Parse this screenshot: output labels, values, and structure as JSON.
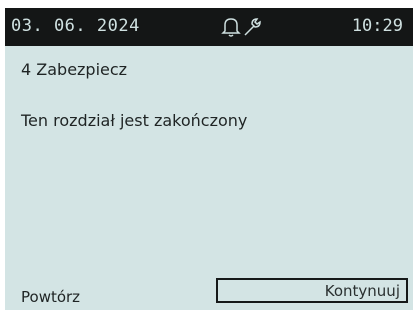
{
  "status_bar": {
    "date": "03. 06. 2024",
    "time": "10:29",
    "icons": [
      "bell-icon",
      "wrench-icon"
    ],
    "background": "#141616",
    "text_color": "#cfe0e0"
  },
  "screen": {
    "background": "#d3e4e4",
    "section_title": "4 Zabezpiecz",
    "message": "Ten rozdział jest zakończony"
  },
  "footer": {
    "repeat_label": "Powtórz",
    "continue_label": "Kontynuuj"
  }
}
